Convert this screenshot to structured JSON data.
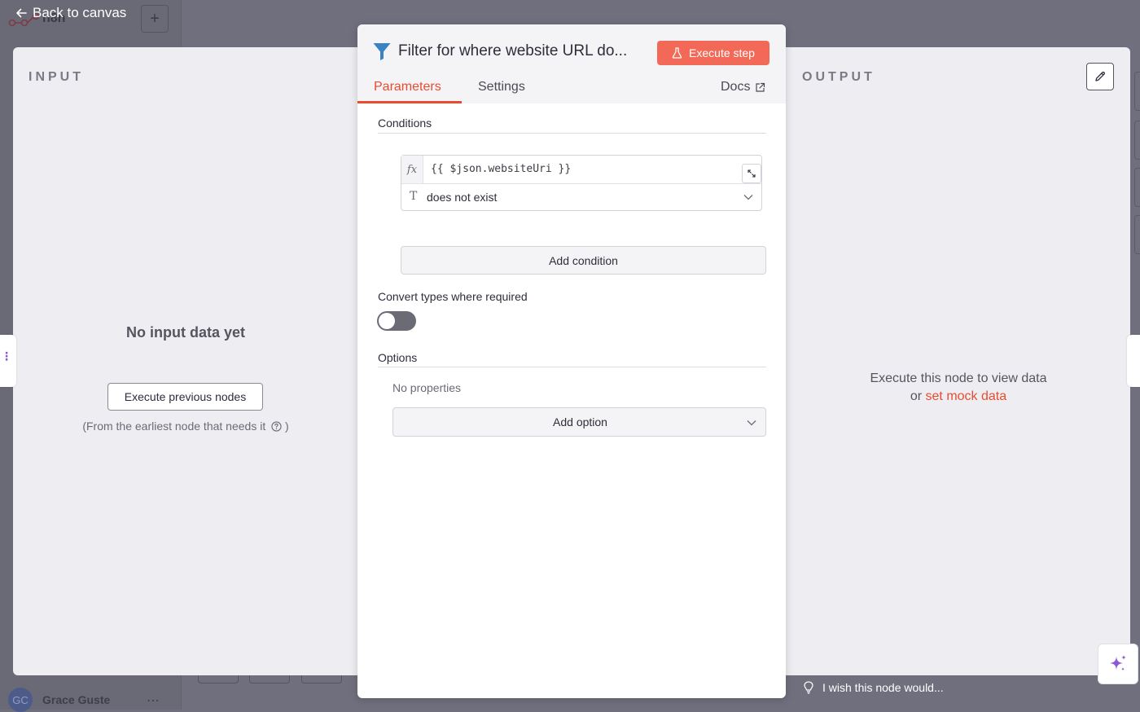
{
  "background": {
    "app_name": "n8n",
    "user_initials": "GC",
    "user_name": "Grace Guste",
    "more_glyph": "⋯",
    "new_glyph": "+"
  },
  "nav": {
    "back_label": "Back to canvas"
  },
  "input_panel": {
    "label": "INPUT",
    "empty_title": "No input data yet",
    "execute_button": "Execute previous nodes",
    "hint": "(From the earliest node that needs it",
    "hint_close": ")"
  },
  "output_panel": {
    "label": "OUTPUT",
    "message_line1": "Execute this node to view data",
    "message_or": "or",
    "mock_link": "set mock data"
  },
  "node": {
    "title": "Filter for where website URL do...",
    "execute_button": "Execute step",
    "tabs": {
      "parameters": "Parameters",
      "settings": "Settings",
      "docs": "Docs"
    },
    "conditions": {
      "heading": "Conditions",
      "fx_label": "fx",
      "expression": "{{ $json.websiteUri }}",
      "type_glyph": "T",
      "operator": "does not exist",
      "add_button": "Add condition"
    },
    "convert_types": {
      "label": "Convert types where required",
      "enabled": false
    },
    "options": {
      "heading": "Options",
      "empty": "No properties",
      "add_button": "Add option"
    }
  },
  "feedback": {
    "label": "I wish this node would..."
  },
  "colors": {
    "accent": "#ea4b2f",
    "execute_bg": "#f26a57",
    "filter_icon": "#3b82c4",
    "ai_sparkle": "#8b5bd7"
  }
}
